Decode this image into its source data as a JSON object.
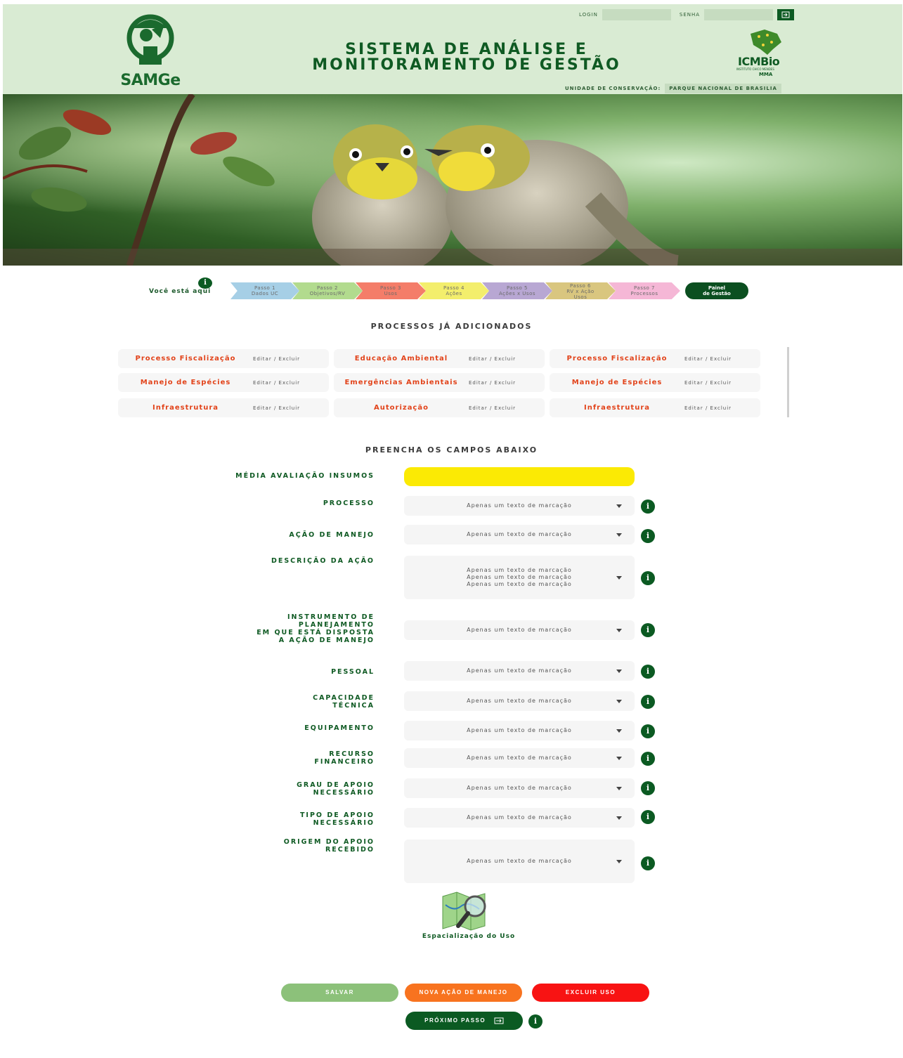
{
  "header": {
    "logo_text": "SAMGe",
    "title_line1": "SISTEMA DE ANÁLISE E",
    "title_line2": "MONITORAMENTO DE GESTÃO",
    "login_label": "LOGIN",
    "senha_label": "SENHA",
    "icmbio_text": "ICMBio",
    "icmbio_sub": "INSTITUTO CHICO MENDES",
    "icmbio_mma": "MMA",
    "unidade_label": "UNIDADE DE CONSERVAÇÃO:",
    "unidade_value": "PARQUE NACIONAL DE BRASILIA"
  },
  "steps": {
    "here_label": "Você está aqui",
    "items": [
      {
        "line1": "Passo 1",
        "line2": "Dados UC",
        "color": "#a6cfe6"
      },
      {
        "line1": "Passo 2",
        "line2": "Objetivos/RV",
        "color": "#b2db8e"
      },
      {
        "line1": "Passo 3",
        "line2": "Usos",
        "color": "#f47d69"
      },
      {
        "line1": "Passo 4",
        "line2": "Ações",
        "color": "#f3ee6c"
      },
      {
        "line1": "Passo 5",
        "line2": "Ações x Usos",
        "color": "#b8a7d3"
      },
      {
        "line1": "Passo 6",
        "line2": "RV x Ação",
        "line3": "Usos",
        "color": "#d9c67f"
      },
      {
        "line1": "Passo 7",
        "line2": "Processos",
        "color": "#f5b7d6"
      }
    ],
    "final_line1": "Painel",
    "final_line2": "de Gestão"
  },
  "processes": {
    "title": "PROCESSOS JÁ ADICIONADOS",
    "actions": "Editar  /  Excluir",
    "items": [
      "Processo Fiscalização",
      "Educação Ambiental",
      "Processo Fiscalização",
      "Manejo de Espécies",
      "Emergências Ambientais",
      "Manejo de Espécies",
      "Infraestrutura",
      "Autorização",
      "Infraestrutura"
    ]
  },
  "form": {
    "title": "PREENCHA OS CAMPOS ABAIXO",
    "media_label": "MÉDIA AVALIAÇÃO INSUMOS",
    "placeholder": "Apenas um texto de marcação",
    "placeholder_multi": "Apenas um texto de marcação\nApenas um texto de marcação\nApenas um texto de marcação",
    "labels": {
      "processo": "PROCESSO",
      "acao": "AÇÃO DE MANEJO",
      "descricao": "DESCRIÇÃO DA AÇÃO",
      "instrumento": "INSTRUMENTO DE\nPLANEJAMENTO\nEM QUE ESTÁ DISPOSTA\nA AÇÃO DE MANEJO",
      "pessoal": "PESSOAL",
      "capacidade": "CAPACIDADE\nTÉCNICA",
      "equipamento": "EQUIPAMENTO",
      "recurso": "RECURSO\nFINANCEIRO",
      "grau": "GRAU DE APOIO\nNECESSÁRIO",
      "tipo": "TIPO DE APOIO\nNECESSÁRIO",
      "origem": "ORIGEM DO APOIO\nRECEBIDO"
    },
    "info_glyph": "i"
  },
  "map": {
    "label": "Espacialização do Uso"
  },
  "buttons": {
    "salvar": "SALVAR",
    "nova_acao": "NOVA AÇÃO DE MANEJO",
    "excluir": "EXCLUIR USO",
    "proximo": "PRÓXIMO PASSO"
  },
  "colors": {
    "header_bg": "#d9ebd3",
    "primary_green": "#0b5a22",
    "salvar": "#8cc17a",
    "nova_acao": "#f8731f",
    "excluir": "#f81313",
    "highlight_yellow": "#fbea04",
    "process_text": "#e2431a"
  }
}
